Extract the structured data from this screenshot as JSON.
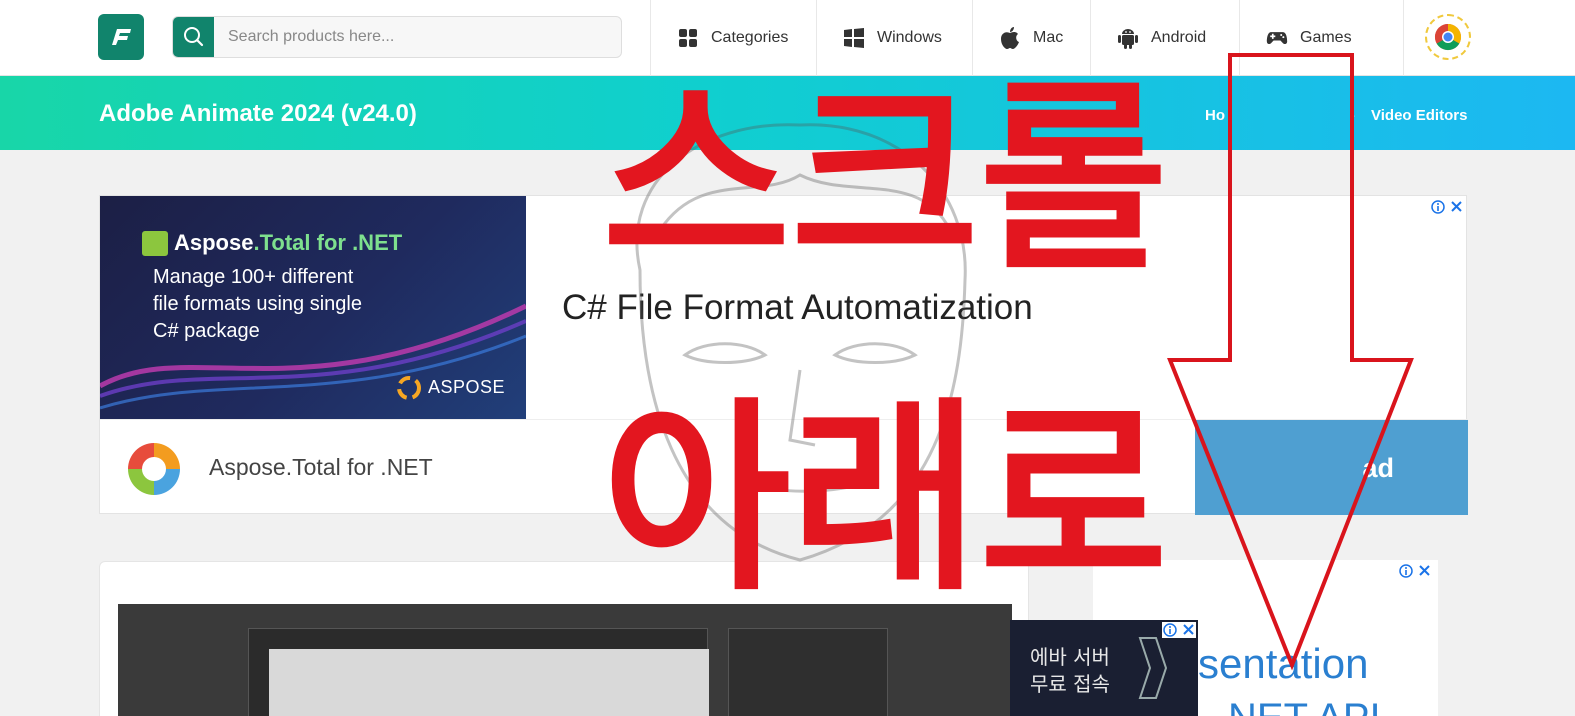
{
  "nav": {
    "search_placeholder": "Search products here...",
    "items": [
      {
        "label": "Categories",
        "icon": "grid-icon"
      },
      {
        "label": "Windows",
        "icon": "windows-icon"
      },
      {
        "label": "Mac",
        "icon": "apple-icon"
      },
      {
        "label": "Android",
        "icon": "android-icon"
      },
      {
        "label": "Games",
        "icon": "gamepad-icon"
      }
    ]
  },
  "page": {
    "title": "Adobe Animate 2024 (v24.0)",
    "breadcrumb_home": "Ho",
    "breadcrumb_last": "Video Editors"
  },
  "ad_main": {
    "product_line": "Aspose",
    "product_accent": ".Total for .NET",
    "body_lines": [
      "Manage 100+ different",
      "file formats using single",
      "C# package"
    ],
    "brand": "ASPOSE",
    "headline": "C# File Format Automatization",
    "name": "Aspose.Total for .NET",
    "button": "ad"
  },
  "ad_popup": {
    "lines": [
      "에바 서버",
      "무료 접속"
    ]
  },
  "ad_side": {
    "line1": "sentation",
    "line2": "NET API"
  },
  "overlay": {
    "scroll_word": "스크롤",
    "down_word": "아래로"
  },
  "colors": {
    "brand_green": "#11846c",
    "banner_start": "#18d6a8",
    "banner_end": "#1cb8f2",
    "overlay_red": "#e3161f"
  }
}
